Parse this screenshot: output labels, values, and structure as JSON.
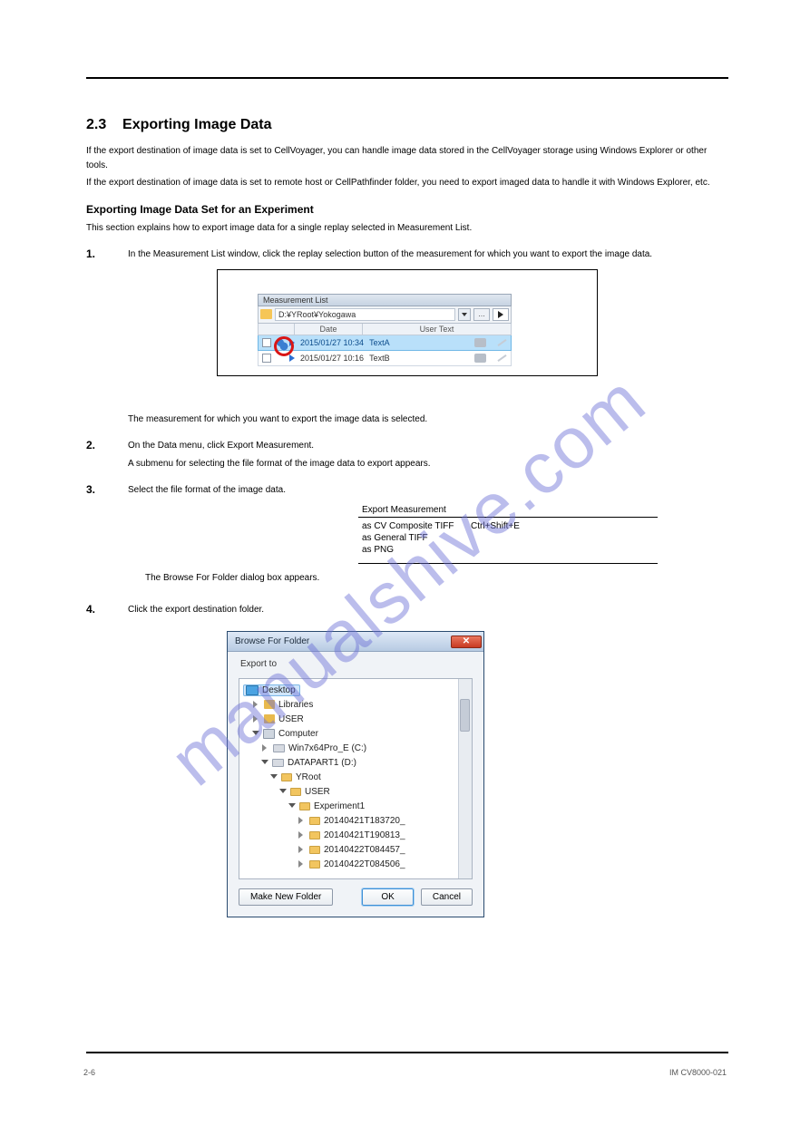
{
  "header": {
    "section_num": "2.3",
    "section_title": "Exporting Image Data"
  },
  "text": {
    "p1a": "If the export destination of image data is set to CellVoyager, you can handle image data stored in the CellVoyager storage using Windows Explorer or other tools.",
    "p1b": "If the export destination of image data is set to remote host or CellPathfinder folder, you need to export imaged data to handle it with Windows Explorer, etc.",
    "p2_title": "Exporting Image Data Set for an Experiment",
    "p2_body": "This section explains how to export image data for a single replay selected in Measurement List.",
    "step1": "In the Measurement List window, click the replay selection button of the measurement for which you want to export the image data.",
    "note1": "The measurement for which you want to export the image data is selected.",
    "step2": "On the Data menu, click Export Measurement.",
    "note2": "A submenu for selecting the file format of the image data to export appears.",
    "step3": "Select the file format of the image data.",
    "ex_below": "The Browse For Folder dialog box appears.",
    "step4": "Click the export destination folder."
  },
  "numbers": {
    "s1": "1.",
    "s2": "2.",
    "s3": "3.",
    "s4": "4."
  },
  "measurement_list": {
    "title": "Measurement List",
    "path": "D:¥YRoot¥Yokogawa",
    "col_date": "Date",
    "col_user": "User Text",
    "rows": [
      {
        "date": "2015/01/27 10:34",
        "text": "TextA",
        "selected": true
      },
      {
        "date": "2015/01/27 10:16",
        "text": "TextB",
        "selected": false
      }
    ]
  },
  "export_menu": {
    "header": "Export Measurement",
    "rows": [
      {
        "left": "as CV Composite TIFF",
        "right": "Ctrl+Shift+E"
      },
      {
        "left": "as General TIFF",
        "right": ""
      },
      {
        "left": "as PNG",
        "right": ""
      }
    ]
  },
  "dialog": {
    "title": "Browse For Folder",
    "label": "Export to",
    "make_folder": "Make New Folder",
    "ok": "OK",
    "cancel": "Cancel",
    "tree": {
      "desktop": "Desktop",
      "libraries": "Libraries",
      "user": "USER",
      "computer": "Computer",
      "c": "Win7x64Pro_E (C:)",
      "d": "DATAPART1 (D:)",
      "yroot": "YRoot",
      "user2": "USER",
      "exp": "Experiment1",
      "f1": "20140421T183720_",
      "f2": "20140421T190813_",
      "f3": "20140422T084457_",
      "f4": "20140422T084506_"
    }
  },
  "footer": {
    "page": "2-6",
    "doc": "IM CV8000-021"
  },
  "watermark": "manualshive.com"
}
